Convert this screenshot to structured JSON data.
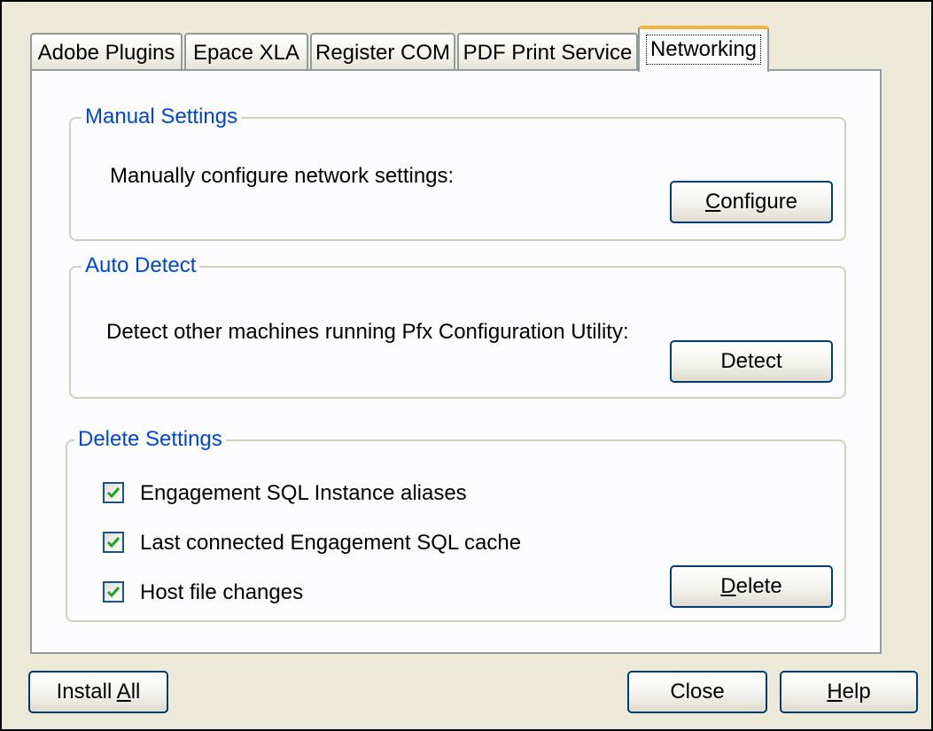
{
  "tabs": [
    {
      "label": "Adobe Plugins",
      "active": false
    },
    {
      "label": "Epace XLA",
      "active": false
    },
    {
      "label": "Register COM",
      "active": false
    },
    {
      "label": "PDF Print Service",
      "active": false
    },
    {
      "label": "Networking",
      "active": true
    }
  ],
  "manual_settings": {
    "title": "Manual Settings",
    "description": "Manually configure network settings:",
    "button_label": "Configure",
    "button_mnemonic": "C"
  },
  "auto_detect": {
    "title": "Auto Detect",
    "description": "Detect other machines running Pfx Configuration Utility:",
    "button_label": "Detect"
  },
  "delete_settings": {
    "title": "Delete Settings",
    "options": [
      {
        "label": "Engagement SQL Instance aliases",
        "checked": true
      },
      {
        "label": "Last connected Engagement SQL cache",
        "checked": true
      },
      {
        "label": "Host file changes",
        "checked": true
      }
    ],
    "button_label": "Delete",
    "button_mnemonic": "D"
  },
  "footer": {
    "install_all_label": "Install All",
    "close_label": "Close",
    "help_label": "Help"
  },
  "colors": {
    "group_title": "#0046d5",
    "active_tab_accent": "#f0b33c",
    "check_mark": "#21a121",
    "dialog_bg": "#ece9d8"
  }
}
